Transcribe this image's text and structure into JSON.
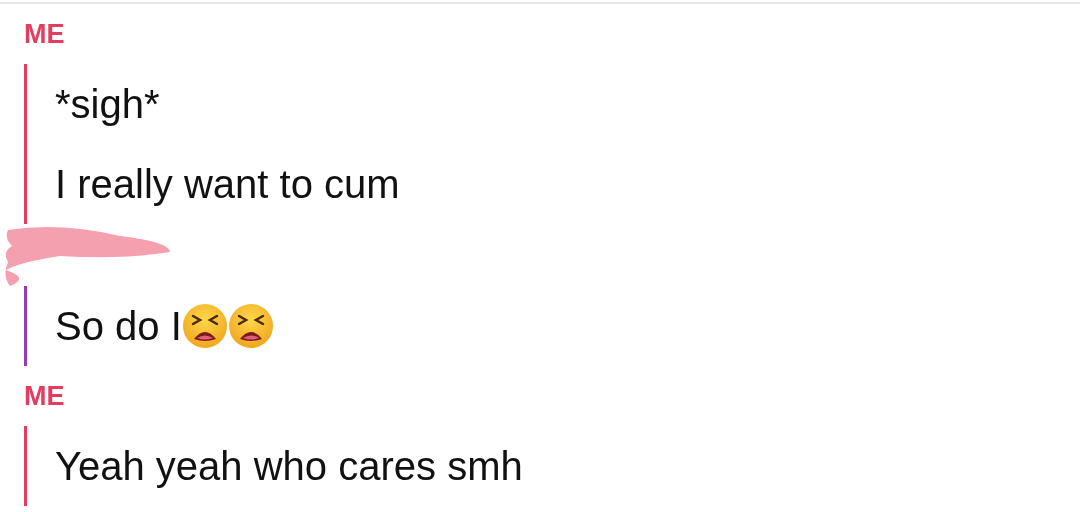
{
  "groups": [
    {
      "sender": {
        "kind": "name",
        "text": "ME"
      },
      "color": "#e23d5f",
      "messages": [
        {
          "parts": [
            {
              "kind": "text",
              "text": "*sigh*"
            }
          ]
        },
        {
          "parts": [
            {
              "kind": "text",
              "text": "I really want to cum"
            }
          ]
        }
      ]
    },
    {
      "sender": {
        "kind": "redacted"
      },
      "color": "#8f3fc0",
      "messages": [
        {
          "parts": [
            {
              "kind": "text",
              "text": "So do I"
            },
            {
              "kind": "emoji"
            },
            {
              "kind": "emoji"
            }
          ]
        }
      ]
    },
    {
      "sender": {
        "kind": "name",
        "text": "ME"
      },
      "color": "#e23d5f",
      "messages": [
        {
          "parts": [
            {
              "kind": "text",
              "text": "Yeah yeah who cares smh"
            }
          ]
        }
      ]
    }
  ]
}
